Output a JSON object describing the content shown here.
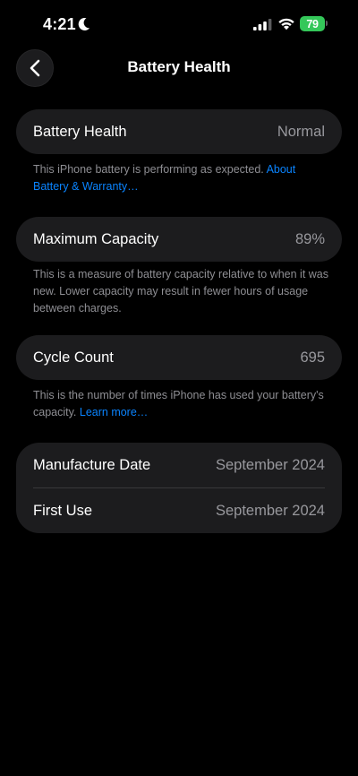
{
  "status_bar": {
    "time": "4:21",
    "battery_level": "79",
    "battery_color": "#34c759"
  },
  "nav": {
    "title": "Battery Health"
  },
  "battery_health": {
    "label": "Battery Health",
    "value": "Normal",
    "footnote_text": "This iPhone battery is performing as expected. ",
    "footnote_link": "About Battery & Warranty…"
  },
  "maximum_capacity": {
    "label": "Maximum Capacity",
    "value": "89%",
    "footnote_text": "This is a measure of battery capacity relative to when it was new. Lower capacity may result in fewer hours of usage between charges."
  },
  "cycle_count": {
    "label": "Cycle Count",
    "value": "695",
    "footnote_text": "This is the number of times iPhone has used your battery's capacity. ",
    "footnote_link": "Learn more…"
  },
  "dates": {
    "manufacture_label": "Manufacture Date",
    "manufacture_value": "September 2024",
    "first_use_label": "First Use",
    "first_use_value": "September 2024"
  },
  "colors": {
    "background": "#000000",
    "card": "#1c1c1e",
    "secondary_text": "#98989d",
    "link": "#0a84ff"
  }
}
